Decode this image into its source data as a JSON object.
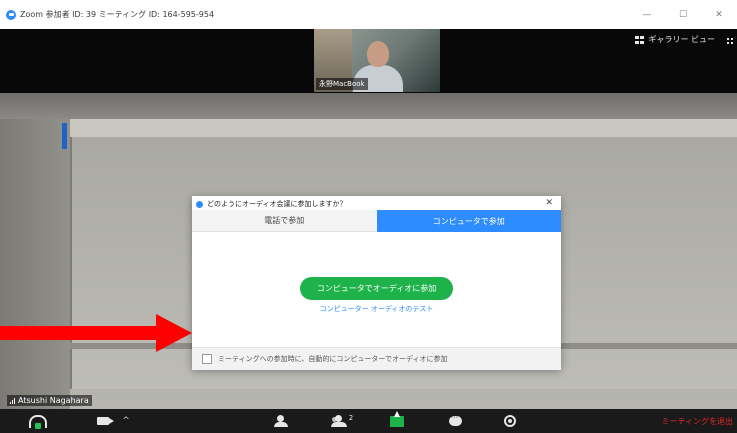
{
  "window": {
    "title": "Zoom 参加者 ID: 39 ミーティング ID: 164-595-954",
    "minimize": "—",
    "maximize": "☐",
    "close": "✕"
  },
  "top_strip": {
    "participant_name": "永野MacBook",
    "gallery_view_label": "ギャラリー ビュー"
  },
  "main_video": {
    "speaker_name": "Atsushi Nagahara"
  },
  "dialog": {
    "title": "どのようにオーディオ会議に参加しますか？",
    "close": "✕",
    "tabs": [
      {
        "label": "電話で参加",
        "active": false
      },
      {
        "label": "コンピュータで参加",
        "active": true
      }
    ],
    "join_button": "コンピュータでオーディオに参加",
    "test_link": "コンピューター オーディオのテスト",
    "footer_checkbox_label": "ミーティングへの参加時に、自動的にコンピューターでオーディオに参加",
    "footer_checkbox_checked": false
  },
  "toolbar": {
    "participants_count": "2",
    "leave_label": "ミーティングを退出"
  },
  "colors": {
    "accent_blue": "#2d8cff",
    "join_green": "#1db34a",
    "arrow_red": "#ff0000",
    "leave_red": "#e02828"
  },
  "icons": [
    "zoom-logo-icon",
    "grid-icon",
    "more-icon",
    "signal-icon",
    "headphone-icon",
    "camera-icon",
    "caret-up-icon",
    "host-icon",
    "participants-icon",
    "share-screen-icon",
    "chat-icon",
    "record-icon",
    "checkbox-icon"
  ]
}
